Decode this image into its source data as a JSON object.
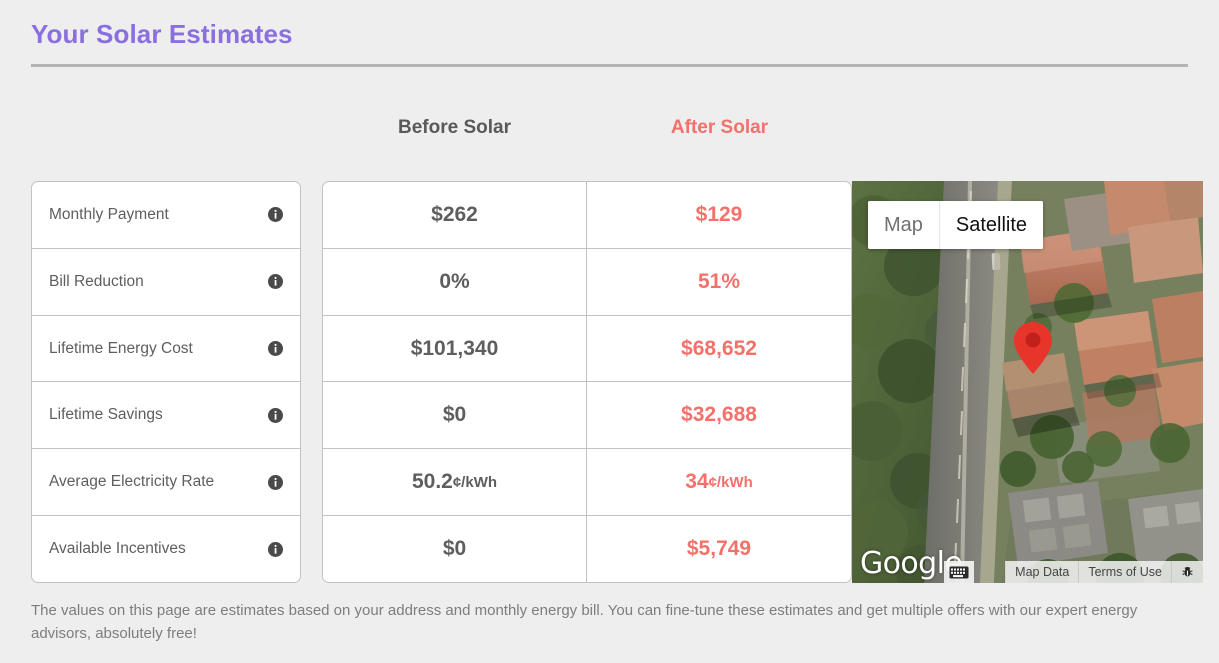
{
  "header": {
    "title": "Your Solar Estimates",
    "title_color": "#8a6fe0"
  },
  "columns": {
    "before_label": "Before Solar",
    "after_label": "After Solar",
    "before_color": "#595959",
    "after_color": "#f4706a"
  },
  "rows": [
    {
      "label": "Monthly Payment",
      "info_icon": "info-icon",
      "before": "$262",
      "before_unit": "",
      "after": "$129",
      "after_unit": ""
    },
    {
      "label": "Bill Reduction",
      "info_icon": "info-icon",
      "before": "0%",
      "before_unit": "",
      "after": "51%",
      "after_unit": ""
    },
    {
      "label": "Lifetime Energy Cost",
      "info_icon": "info-icon",
      "before": "$101,340",
      "before_unit": "",
      "after": "$68,652",
      "after_unit": ""
    },
    {
      "label": "Lifetime Savings",
      "info_icon": "info-icon",
      "before": "$0",
      "before_unit": "",
      "after": "$32,688",
      "after_unit": ""
    },
    {
      "label": "Average Electricity Rate",
      "info_icon": "info-icon",
      "before": "50.2",
      "before_unit": "¢/kWh",
      "after": "34",
      "after_unit": "¢/kWh"
    },
    {
      "label": "Available Incentives",
      "info_icon": "info-icon",
      "before": "$0",
      "before_unit": "",
      "after": "$5,749",
      "after_unit": ""
    }
  ],
  "map": {
    "maptype_map": "Map",
    "maptype_satellite": "Satellite",
    "selected_maptype": "Satellite",
    "attribution": "Google",
    "map_data_label": "Map Data",
    "terms_label": "Terms of Use",
    "keyboard_icon": "keyboard-icon",
    "bug_icon": "bug-report-icon",
    "marker_icon": "map-pin-icon",
    "marker_color": "#e8352b"
  },
  "footer": {
    "disclaimer": "The values on this page are estimates based on your address and monthly energy bill. You can fine-tune these estimates and get multiple offers with our expert energy advisors, absolutely free!"
  }
}
